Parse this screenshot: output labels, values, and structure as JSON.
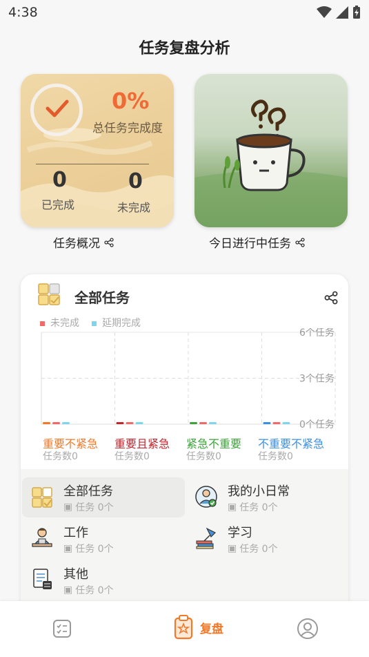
{
  "status": {
    "time": "4:38"
  },
  "header": {
    "title": "任务复盘分析"
  },
  "overview": {
    "percent": "0%",
    "percent_label": "总任务完成度",
    "done_count": "0",
    "done_label": "已完成",
    "undone_count": "0",
    "undone_label": "未完成",
    "caption": "任务概况"
  },
  "today": {
    "caption": "今日进行中任务"
  },
  "all_tasks": {
    "title": "全部任务",
    "legend": [
      "未完成",
      "延期完成"
    ],
    "chart_data": {
      "type": "bar",
      "categories": [
        "重要不紧急",
        "重要且紧急",
        "紧急不重要",
        "不重要不紧急"
      ],
      "series": [
        {
          "name": "未完成",
          "values": [
            0,
            0,
            0,
            0
          ]
        },
        {
          "name": "延期完成",
          "values": [
            0,
            0,
            0,
            0
          ]
        }
      ],
      "y_ticks": [
        "6个任务",
        "3个任务",
        "0个任务"
      ],
      "ylim": [
        0,
        6
      ]
    },
    "categories": [
      {
        "label": "重要不紧急",
        "count": "任务数0",
        "color": "#f07a2a"
      },
      {
        "label": "重要且紧急",
        "count": "任务数0",
        "color": "#c0262d"
      },
      {
        "label": "紧急不重要",
        "count": "任务数0",
        "color": "#3da33a"
      },
      {
        "label": "不重要不紧急",
        "count": "任务数0",
        "color": "#3d8fe0"
      }
    ],
    "colors": {
      "unfinished": "#f06a6a",
      "delayed": "#7fd6ea"
    }
  },
  "lists": [
    {
      "title": "全部任务",
      "sub": "任务 0个",
      "icon": "grid-check-icon"
    },
    {
      "title": "我的小日常",
      "sub": "任务 0个",
      "icon": "person-check-icon"
    },
    {
      "title": "工作",
      "sub": "任务 0个",
      "icon": "desk-worker-icon"
    },
    {
      "title": "学习",
      "sub": "任务 0个",
      "icon": "lamp-books-icon"
    },
    {
      "title": "其他",
      "sub": "任务 0个",
      "icon": "checklist-icon"
    }
  ],
  "nav": {
    "review_label": "复盘",
    "accent": "#f07a2a"
  }
}
